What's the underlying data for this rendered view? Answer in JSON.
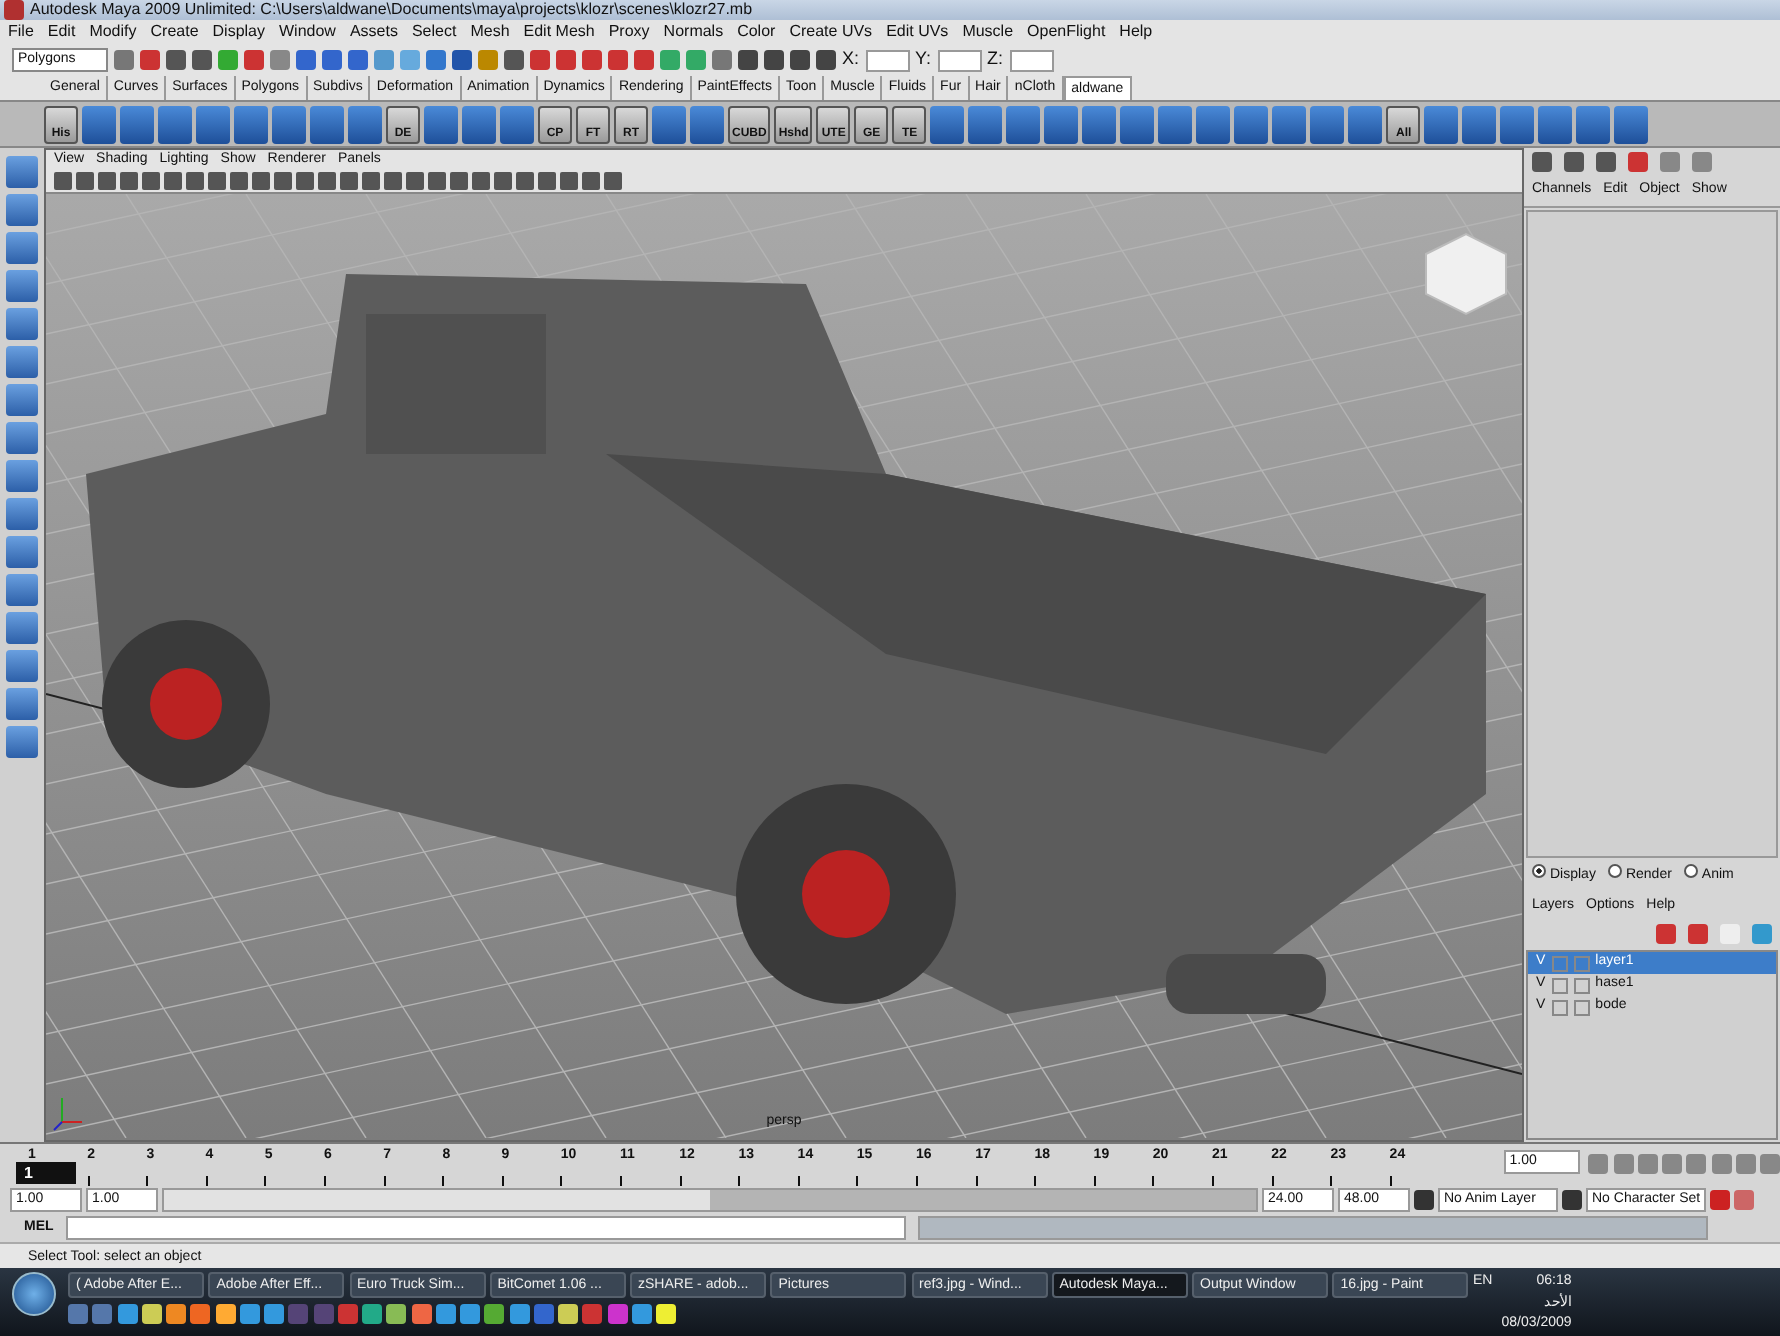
{
  "window": {
    "title": "Autodesk Maya 2009 Unlimited: C:\\Users\\aldwane\\Documents\\maya\\projects\\klozr\\scenes\\klozr27.mb"
  },
  "menu_bar": [
    "File",
    "Edit",
    "Modify",
    "Create",
    "Display",
    "Window",
    "Assets",
    "Select",
    "Mesh",
    "Edit Mesh",
    "Proxy",
    "Normals",
    "Color",
    "Create UVs",
    "Edit UVs",
    "Muscle",
    "OpenFlight",
    "Help"
  ],
  "status_line": {
    "menu_set": "Polygons",
    "coordinate_labels": [
      "X:",
      "Y:",
      "Z:"
    ]
  },
  "shelf_tabs": [
    {
      "label": "General",
      "selected": false
    },
    {
      "label": "Curves",
      "selected": false
    },
    {
      "label": "Surfaces",
      "selected": false
    },
    {
      "label": "Polygons",
      "selected": false
    },
    {
      "label": "Subdivs",
      "selected": false
    },
    {
      "label": "Deformation",
      "selected": false
    },
    {
      "label": "Animation",
      "selected": false
    },
    {
      "label": "Dynamics",
      "selected": false
    },
    {
      "label": "Rendering",
      "selected": false
    },
    {
      "label": "PaintEffects",
      "selected": false
    },
    {
      "label": "Toon",
      "selected": false
    },
    {
      "label": "Muscle",
      "selected": false
    },
    {
      "label": "Fluids",
      "selected": false
    },
    {
      "label": "Fur",
      "selected": false
    },
    {
      "label": "Hair",
      "selected": false
    },
    {
      "label": "nCloth",
      "selected": false
    },
    {
      "label": "aldwane",
      "selected": true
    }
  ],
  "shelf": [
    {
      "kind": "labeled",
      "label": "His"
    },
    {
      "kind": "icon"
    },
    {
      "kind": "icon"
    },
    {
      "kind": "icon"
    },
    {
      "kind": "icon"
    },
    {
      "kind": "icon"
    },
    {
      "kind": "icon"
    },
    {
      "kind": "icon"
    },
    {
      "kind": "icon"
    },
    {
      "kind": "labeled",
      "label": "DE"
    },
    {
      "kind": "icon"
    },
    {
      "kind": "icon"
    },
    {
      "kind": "icon"
    },
    {
      "kind": "labeled",
      "label": "CP"
    },
    {
      "kind": "labeled",
      "label": "FT"
    },
    {
      "kind": "labeled",
      "label": "RT"
    },
    {
      "kind": "icon"
    },
    {
      "kind": "icon"
    },
    {
      "kind": "labeled",
      "label": "CUBD"
    },
    {
      "kind": "labeled",
      "label": "Hshd"
    },
    {
      "kind": "labeled",
      "label": "UTE"
    },
    {
      "kind": "labeled",
      "label": "GE"
    },
    {
      "kind": "labeled",
      "label": "TE"
    },
    {
      "kind": "icon"
    },
    {
      "kind": "icon"
    },
    {
      "kind": "icon"
    },
    {
      "kind": "icon"
    },
    {
      "kind": "icon"
    },
    {
      "kind": "icon"
    },
    {
      "kind": "icon"
    },
    {
      "kind": "icon"
    },
    {
      "kind": "icon"
    },
    {
      "kind": "icon"
    },
    {
      "kind": "icon"
    },
    {
      "kind": "icon"
    },
    {
      "kind": "labeled",
      "label": "All"
    },
    {
      "kind": "icon"
    },
    {
      "kind": "icon"
    },
    {
      "kind": "icon"
    },
    {
      "kind": "icon"
    },
    {
      "kind": "icon"
    },
    {
      "kind": "icon"
    }
  ],
  "panel_menu": [
    "View",
    "Shading",
    "Lighting",
    "Show",
    "Renderer",
    "Panels"
  ],
  "viewport": {
    "camera": "persp"
  },
  "channel_box": {
    "menu": [
      "Channels",
      "Edit",
      "Object",
      "Show"
    ]
  },
  "layer_editor": {
    "modes": [
      {
        "label": "Display",
        "selected": true
      },
      {
        "label": "Render",
        "selected": false
      },
      {
        "label": "Anim",
        "selected": false
      }
    ],
    "menu": [
      "Layers",
      "Options",
      "Help"
    ],
    "layers": [
      {
        "visibility": "V",
        "name": "layer1",
        "selected": true
      },
      {
        "visibility": "V",
        "name": "hase1",
        "selected": false
      },
      {
        "visibility": "V",
        "name": "bode",
        "selected": false
      }
    ]
  },
  "time_slider": {
    "ticks": [
      "1",
      "2",
      "3",
      "4",
      "5",
      "6",
      "7",
      "8",
      "9",
      "10",
      "11",
      "12",
      "13",
      "14",
      "15",
      "16",
      "17",
      "18",
      "19",
      "20",
      "21",
      "22",
      "23",
      "24"
    ],
    "current_frame_marker": "1",
    "current_frame": "1.00"
  },
  "range_slider": {
    "level": 0.5,
    "start": "1.00",
    "playback_start": "1.00",
    "playback_end": "24.00",
    "end": "48.00",
    "anim_layer": "No Anim Layer",
    "character_set": "No Character Set"
  },
  "command_line": {
    "label": "MEL"
  },
  "help_line": "Select Tool: select an object",
  "taskbar": {
    "buttons": [
      {
        "label": "( Adobe After E...",
        "selected": false
      },
      {
        "label": "Adobe After Eff...",
        "selected": false
      },
      {
        "label": "Euro Truck Sim...",
        "selected": false
      },
      {
        "label": "BitComet 1.06 ...",
        "selected": false
      },
      {
        "label": "zSHARE - adob...",
        "selected": false
      },
      {
        "label": "Pictures",
        "selected": false
      },
      {
        "label": "ref3.jpg - Wind...",
        "selected": false
      },
      {
        "label": "Autodesk Maya...",
        "selected": true
      },
      {
        "label": "Output Window",
        "selected": false
      },
      {
        "label": "16.jpg - Paint",
        "selected": false
      }
    ],
    "language": "EN",
    "time": "06:18",
    "day": "الأحد",
    "date": "08/03/2009"
  }
}
